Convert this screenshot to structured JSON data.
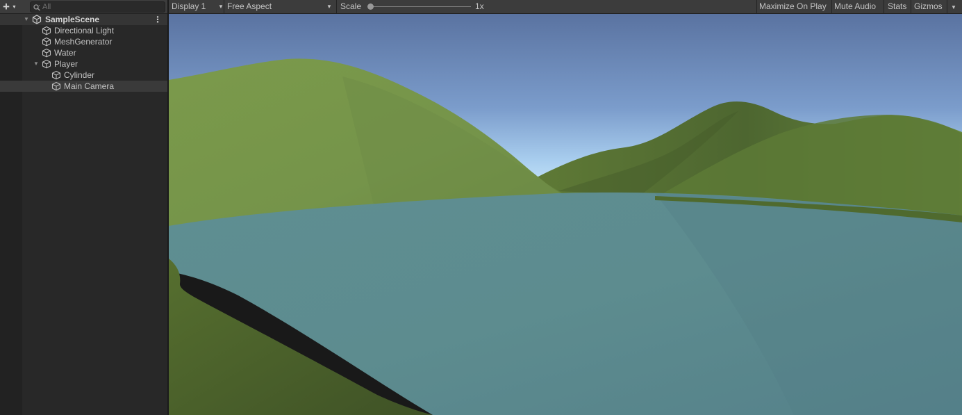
{
  "hierarchy": {
    "search": {
      "placeholder": "All"
    },
    "scene": "SampleScene",
    "items": [
      {
        "label": "Directional Light"
      },
      {
        "label": "MeshGenerator"
      },
      {
        "label": "Water"
      },
      {
        "label": "Player"
      },
      {
        "label": "Cylinder"
      },
      {
        "label": "Main Camera"
      }
    ]
  },
  "game_toolbar": {
    "display": "Display 1",
    "aspect": "Free Aspect",
    "scale_label": "Scale",
    "scale_value": "1x",
    "maximize_on_play": "Maximize On Play",
    "mute_audio": "Mute Audio",
    "stats": "Stats",
    "gizmos": "Gizmos"
  },
  "colors": {
    "sky_top": "#5a77a3",
    "sky_horizon": "#b9dcf2",
    "grass_light": "#78974a",
    "grass_dark": "#4a5f2c",
    "water": "#5b8a8e",
    "panel_bg": "#282828",
    "toolbar_bg": "#3c3c3c"
  },
  "icons": {
    "add": "plus-icon",
    "search": "search-icon",
    "scene": "unity-scene-icon",
    "gameobject": "cube-icon"
  }
}
